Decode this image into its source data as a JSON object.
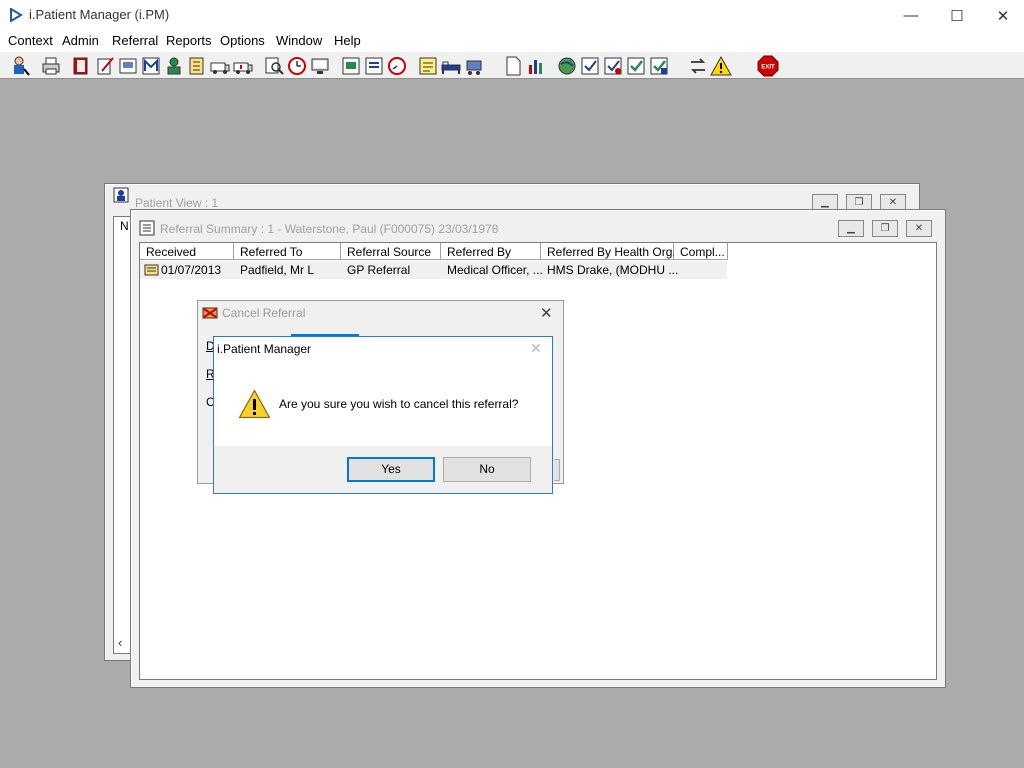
{
  "app": {
    "title": "i.Patient Manager (i.PM)",
    "window_controls": {
      "minimize": "—",
      "maximize": "☐",
      "close": "✕"
    }
  },
  "menu": [
    "Context",
    "Admin",
    "Referral",
    "Reports",
    "Options",
    "Window",
    "Help"
  ],
  "toolbar": {
    "buttons": [
      "patient-search-icon",
      "printer-icon",
      "book-icon",
      "edit-doc-icon",
      "photo-doc-icon",
      "mail-m-icon",
      "person-card-icon",
      "form-icon",
      "ambulance-icon",
      "ambulance2-icon",
      "magnify-doc-icon",
      "alarm-clock-icon",
      "monitor-icon",
      "chart-doc-icon",
      "list-doc-icon",
      "clock-gauge-icon",
      "note-icon",
      "bed-icon",
      "cart-icon",
      "blank-page-icon",
      "bar-chart-icon",
      "globe-icon",
      "check-doc-icon",
      "check-doc2-icon",
      "check-green-icon",
      "check-green2-icon",
      "swap-arrows-icon",
      "warning-icon",
      "exit-icon"
    ],
    "exit_label": "EXIT"
  },
  "patient_view": {
    "title": "Patient View : 1"
  },
  "referral_summary": {
    "title": "Referral Summary : 1 - Waterstone, Paul (F000075) 23/03/1978",
    "columns": [
      "Received",
      "Referred To",
      "Referral Source",
      "Referred By",
      "Referred By Health Org.",
      "Compl..."
    ],
    "rows": [
      [
        "01/07/2013",
        "Padfield, Mr L",
        "GP Referral",
        "Medical Officer, ...",
        "HMS Drake, (MODHU ...",
        ""
      ]
    ]
  },
  "cancel_dialog": {
    "title": "Cancel Referral",
    "letters": [
      "D",
      "R",
      "C"
    ]
  },
  "msgbox": {
    "title": "i.Patient Manager",
    "message": "Are you sure you wish to cancel this referral?",
    "yes": "Yes",
    "no": "No"
  },
  "colors": {
    "desktop": "#ababab",
    "accent": "#0078d7"
  }
}
